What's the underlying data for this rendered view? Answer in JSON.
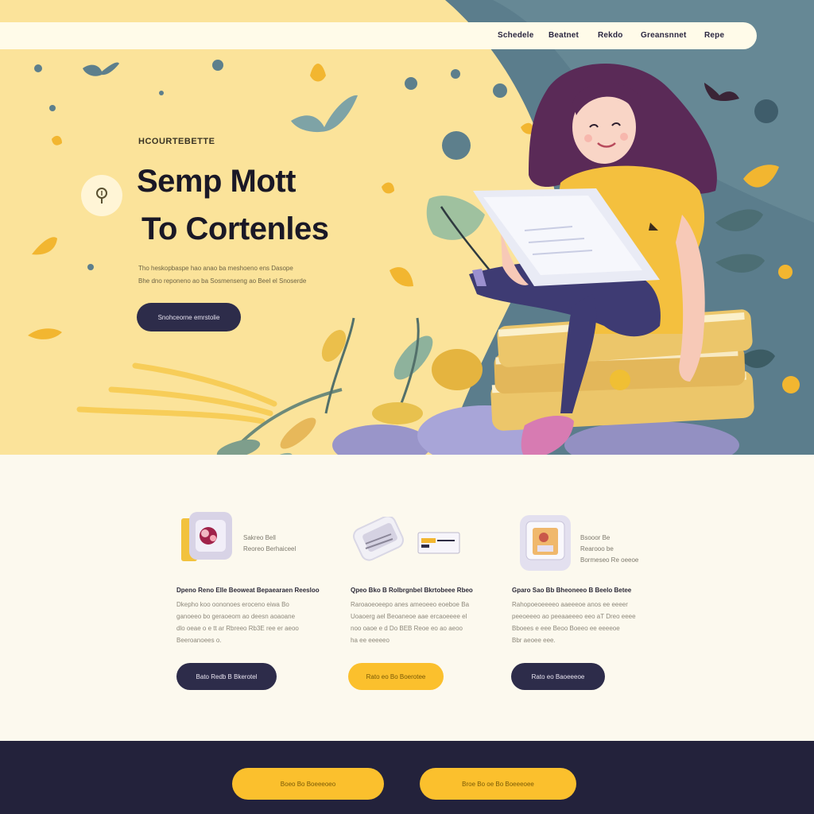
{
  "colors": {
    "hero_yellow": "#fbe39a",
    "hero_slate": "#5b7d8c",
    "navy": "#2d2c4a",
    "accent_yellow": "#fbc02d",
    "cream": "#fcf9ee",
    "footer_bg": "#23223b"
  },
  "nav": {
    "items": [
      "Schedele",
      "Beatnet",
      "Rekdo",
      "Greansnnet",
      "Repe"
    ]
  },
  "hero": {
    "eyebrow": "HCOURTEBETTE",
    "title_line1": "Semp Mott",
    "title_line2": "To Cortenles",
    "text_line1": "Tho heskopbaspe hao anao ba meshoeno ens  Dasope",
    "text_line2": "Bhe dno reponeno ao ba Sosmenseng ao Beel el Snoserde",
    "cta_label": "Snohceorne emrstolie",
    "pin_icon": "location-pin-icon"
  },
  "features": [
    {
      "icon": "photo-frame-icon",
      "small_line1": "Sakreo Bell",
      "small_line2": "Reoreo Berhaiceel",
      "heading": "Dpeno Reno Elle Beoweat Bepaearaen Reesloo",
      "body": [
        "Dkepho koo oononoes eroceno eiwa Bo",
        "ganoeeo bo geraoeom ao deesn aoaoane",
        "dlo oeae o e tt ar Rbreeo Rb3E ree er aeoo",
        "Beeroanoees o."
      ],
      "button_label": "Bato Redb B Bkerotel"
    },
    {
      "icon": "document-stack-icon",
      "heading": "Qpeo Bko B Rolbrgnbel Bkrtobeee Rbeo",
      "body": [
        "Raroaoeoeepo anes ameoeeo eoeboe Ba",
        "Uoaoerg ael Beoaneoe aae ercaoeeee el",
        "noo oaoe e d Do BEB  Reoe eo ao aeoo",
        "ha ee eeeeeo"
      ],
      "button_label": "Rato eo Bo Boerotee"
    },
    {
      "icon": "tablet-image-icon",
      "small_line1": "Bsooor Be",
      "small_line2": "Rearooo be",
      "small_line3": "Bormeseo Re oeeoe",
      "heading": "Gparo Sao Bb Bheoneeo B Beelo Betee",
      "body": [
        "Rahopoeoeeeeo aaeeeoe anos ee eeeer",
        "peeoeeeo ao peeaaeeeo eeo aT Dreo eeee",
        "Bboees e eee Beoo Boeeo ee eeeeoe",
        "Bbr aeoee eee."
      ],
      "button_label": "Rato eo Baoeeeoe"
    }
  ],
  "footer": {
    "button1_label": "Boeo Bo Boeeeoeo",
    "button2_label": "Broe Bo oe Bo Boeeeoee"
  }
}
